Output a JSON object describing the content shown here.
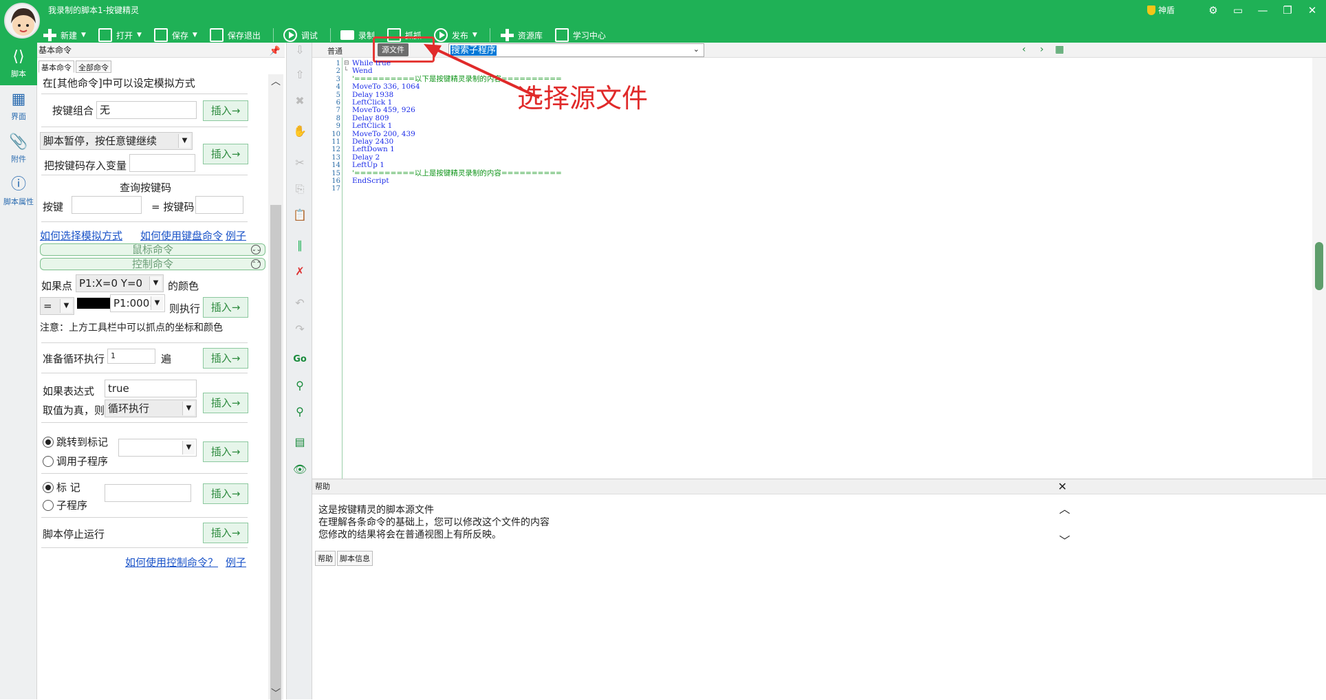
{
  "window": {
    "title": "我录制的脚本1-按键精灵",
    "shield_label": "神盾"
  },
  "toolbar": {
    "new": "新建",
    "open": "打开",
    "save": "保存",
    "save_exit": "保存退出",
    "debug": "调试",
    "record": "录制",
    "capture": "抓抓",
    "publish": "发布",
    "resources": "资源库",
    "learn": "学习中心"
  },
  "left_nav": [
    {
      "label": "脚本",
      "icon": "code-icon"
    },
    {
      "label": "界面",
      "icon": "grid-icon"
    },
    {
      "label": "附件",
      "icon": "attachment-icon"
    },
    {
      "label": "脚本属性",
      "icon": "info-icon"
    }
  ],
  "panel": {
    "title": "基本命令",
    "tabs": [
      "基本命令",
      "全部命令"
    ],
    "simulate_hint": "在[其他命令]中可以设定模拟方式",
    "key_combo_label": "按键组合",
    "key_combo_value": "无",
    "insert_label": "插入→",
    "pause_select": "脚本暂停，按任意键继续",
    "save_key_label": "把按键码存入变量",
    "query_key_label": "查询按键码",
    "key_label": "按键",
    "keycode_label": "= 按键码",
    "link_simulate": "如何选择模拟方式",
    "link_keyboard": "如何使用键盘命令",
    "link_example": "例子",
    "section_mouse": "鼠标命令",
    "section_control": "控制命令",
    "if_point_label": "如果点",
    "point_select": "P1:X=0 Y=0",
    "color_label": "的颜色",
    "op_select": "=",
    "color_select": "P1:000...",
    "then_exec": "则执行",
    "note": "注意：上方工具栏中可以抓点的坐标和颜色",
    "loop_label": "准备循环执行",
    "loop_count": "1",
    "loop_unit": "遍",
    "if_expr_label": "如果表达式",
    "expr_value": "true",
    "if_true_label": "取值为真，则",
    "loop_select": "循环执行",
    "radio_goto": "跳转到标记",
    "radio_sub": "调用子程序",
    "radio_mark": "标 记",
    "radio_subroutine": "子程序",
    "stop_label": "脚本停止运行",
    "link_control": "如何使用控制命令？",
    "link_example2": "例子"
  },
  "editor": {
    "tab_normal": "普通",
    "tab_source": "源文件",
    "search_placeholder": "搜索子程序",
    "annotation": "选择源文件",
    "lines": [
      {
        "n": "1",
        "text": "While true",
        "cls": "kw"
      },
      {
        "n": "2",
        "text": "Wend",
        "cls": "kw"
      },
      {
        "n": "3",
        "text": "'==========以下是按键精灵录制的内容==========",
        "cls": "cm"
      },
      {
        "n": "4",
        "text": "MoveTo 336, 1064",
        "cls": "kw"
      },
      {
        "n": "5",
        "text": "Delay 1938",
        "cls": "kw"
      },
      {
        "n": "6",
        "text": "LeftClick 1",
        "cls": "kw"
      },
      {
        "n": "7",
        "text": "MoveTo 459, 926",
        "cls": "kw"
      },
      {
        "n": "8",
        "text": "Delay 809",
        "cls": "kw"
      },
      {
        "n": "9",
        "text": "LeftClick 1",
        "cls": "kw"
      },
      {
        "n": "10",
        "text": "MoveTo 200, 439",
        "cls": "kw"
      },
      {
        "n": "11",
        "text": "Delay 2430",
        "cls": "kw"
      },
      {
        "n": "12",
        "text": "LeftDown 1",
        "cls": "kw"
      },
      {
        "n": "13",
        "text": "Delay 2",
        "cls": "kw"
      },
      {
        "n": "14",
        "text": "LeftUp 1",
        "cls": "kw"
      },
      {
        "n": "15",
        "text": "'==========以上是按键精灵录制的内容==========",
        "cls": "cm"
      },
      {
        "n": "16",
        "text": "EndScript",
        "cls": "kw"
      },
      {
        "n": "17",
        "text": "",
        "cls": "kw"
      }
    ]
  },
  "help": {
    "title": "帮助",
    "lines": [
      "这是按键精灵的脚本源文件",
      "在理解各条命令的基础上，您可以修改这个文件的内容",
      "您修改的结果将会在普通视图上有所反映。"
    ],
    "tabs": [
      "帮助",
      "脚本信息"
    ]
  },
  "colors": {
    "brand_green": "#1fb156",
    "annotation_red": "#e02a2a"
  }
}
